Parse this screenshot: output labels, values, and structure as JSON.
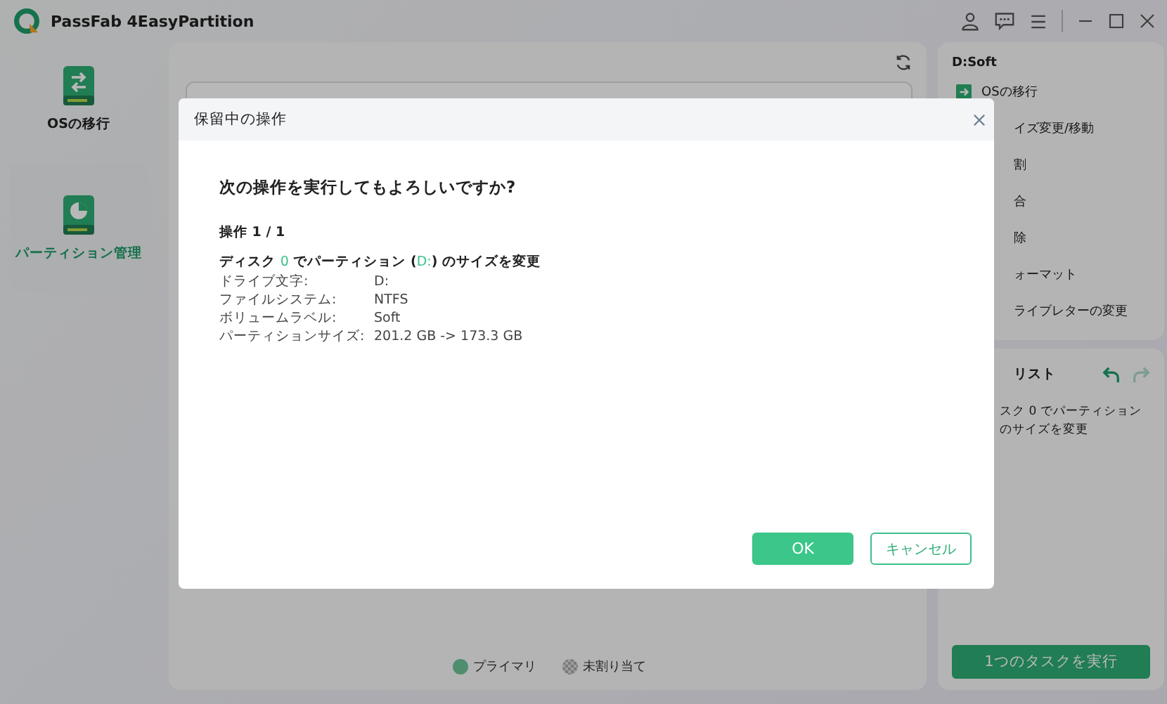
{
  "window": {
    "title": "PassFab 4EasyPartition"
  },
  "sidebar": {
    "items": [
      {
        "label": "OSの移行",
        "selected": false
      },
      {
        "label": "パーティション管理",
        "selected": true
      }
    ]
  },
  "legend": [
    {
      "label": "プライマリ",
      "kind": "primary"
    },
    {
      "label": "未割り当て",
      "kind": "unallocated"
    }
  ],
  "actions_panel": {
    "title": "D:Soft",
    "items": [
      {
        "label": "OSの移行",
        "icon": true
      },
      {
        "label": "イズ変更/移動",
        "icon": false
      },
      {
        "label": "割",
        "icon": false
      },
      {
        "label": "合",
        "icon": false
      },
      {
        "label": "除",
        "icon": false
      },
      {
        "label": "ォーマット",
        "icon": false
      },
      {
        "label": "ライブレターの変更",
        "icon": false
      }
    ]
  },
  "task_list": {
    "title": "リスト",
    "undo": {
      "disabled": false
    },
    "redo": {
      "disabled": true
    },
    "lines": [
      "スク 0 でパーティション",
      "のサイズを変更"
    ],
    "run_button": "1つのタスクを実行"
  },
  "dialog": {
    "title": "保留中の操作",
    "question": "次の操作を実行してもよろしいですか?",
    "counter": "操作 1 / 1",
    "operation": [
      {
        "text": "ディスク ",
        "highlight": false
      },
      {
        "text": "0",
        "highlight": true
      },
      {
        "text": " でパーティション (",
        "highlight": false
      },
      {
        "text": "D:",
        "highlight": true
      },
      {
        "text": ") のサイズを変更",
        "highlight": false
      }
    ],
    "details": [
      {
        "label": "ドライブ文字:",
        "value": "D:"
      },
      {
        "label": "ファイルシステム:",
        "value": "NTFS"
      },
      {
        "label": "ボリュームラベル:",
        "value": "Soft"
      },
      {
        "label": "パーティションサイズ:",
        "value": "201.2 GB -> 173.3 GB"
      }
    ],
    "ok_button": "OK",
    "cancel_button": "キャンセル"
  }
}
